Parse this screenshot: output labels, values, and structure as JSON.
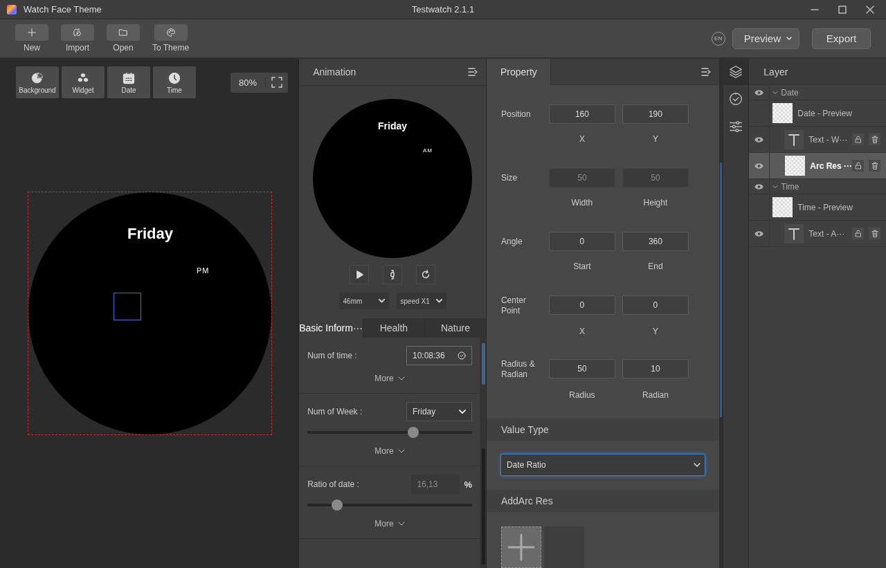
{
  "window": {
    "title": "Watch Face Theme",
    "document_title": "Testwatch 2.1.1"
  },
  "toolbar": {
    "buttons": [
      {
        "kind": "new",
        "label": "New"
      },
      {
        "kind": "import",
        "label": "Import"
      },
      {
        "kind": "open",
        "label": "Open"
      },
      {
        "kind": "theme",
        "label": "To Theme"
      }
    ],
    "language": "EN",
    "preview": "Preview",
    "export": "Export"
  },
  "canvas": {
    "tools": [
      {
        "kind": "background",
        "label": "Background"
      },
      {
        "kind": "widget",
        "label": "Widget"
      },
      {
        "kind": "date",
        "label": "Date"
      },
      {
        "kind": "time",
        "label": "Time"
      }
    ],
    "zoom": "80%",
    "weekday": "Friday",
    "ampm": "PM"
  },
  "animation": {
    "title": "Animation",
    "weekday": "Friday",
    "ampm": "AM",
    "size": "46mm",
    "speed": "speed X1",
    "tabs": [
      {
        "label": "Basic Inform···",
        "selected": true
      },
      {
        "label": "Health",
        "selected": false
      },
      {
        "label": "Nature",
        "selected": false
      }
    ],
    "sections": [
      {
        "kind": "time",
        "label": "Num of time :",
        "value": "10:08:36",
        "more": "More"
      },
      {
        "kind": "select",
        "label": "Num of Week :",
        "value": "Friday",
        "level": 0.655,
        "more": "More"
      },
      {
        "kind": "percent",
        "label": "Ratio of date :",
        "value": "16,13",
        "unit": "%",
        "level": 0.155,
        "more": "More"
      }
    ]
  },
  "property": {
    "title": "Property",
    "rows": [
      {
        "label": "Position",
        "disabled": false,
        "fields": [
          {
            "value": "160",
            "caption": "X"
          },
          {
            "value": "190",
            "caption": "Y"
          }
        ]
      },
      {
        "label": "Size",
        "disabled": true,
        "fields": [
          {
            "value": "50",
            "caption": "Width"
          },
          {
            "value": "50",
            "caption": "Height"
          }
        ]
      },
      {
        "label": "Angle",
        "disabled": false,
        "fields": [
          {
            "value": "0",
            "caption": "Start"
          },
          {
            "value": "360",
            "caption": "End"
          }
        ]
      },
      {
        "label": "Center Point",
        "disabled": false,
        "fields": [
          {
            "value": "0",
            "caption": "X"
          },
          {
            "value": "0",
            "caption": "Y"
          }
        ]
      },
      {
        "label": "Radius & Radian",
        "disabled": false,
        "fields": [
          {
            "value": "50",
            "caption": "Radius"
          },
          {
            "value": "10",
            "caption": "Radian"
          }
        ]
      }
    ],
    "value_type": {
      "heading": "Value Type",
      "value": "Date Ratio",
      "focused": true
    },
    "resources": {
      "heading": "AddArc Res"
    }
  },
  "layers": {
    "title": "Layer",
    "tree": [
      {
        "label": "Date",
        "visible": true,
        "expanded": true,
        "children": [
          {
            "kind": "preview",
            "label": "Date - Preview",
            "selected": false
          },
          {
            "kind": "text",
            "label": "Text - W···",
            "visible": true,
            "selected": false
          },
          {
            "kind": "image",
            "label": "Arc Res ···",
            "visible": true,
            "selected": true
          }
        ]
      },
      {
        "label": "Time",
        "visible": true,
        "expanded": true,
        "children": [
          {
            "kind": "preview",
            "label": "Time - Preview",
            "selected": false
          },
          {
            "kind": "text",
            "label": "Text - A···",
            "visible": true,
            "selected": false
          }
        ]
      }
    ]
  }
}
